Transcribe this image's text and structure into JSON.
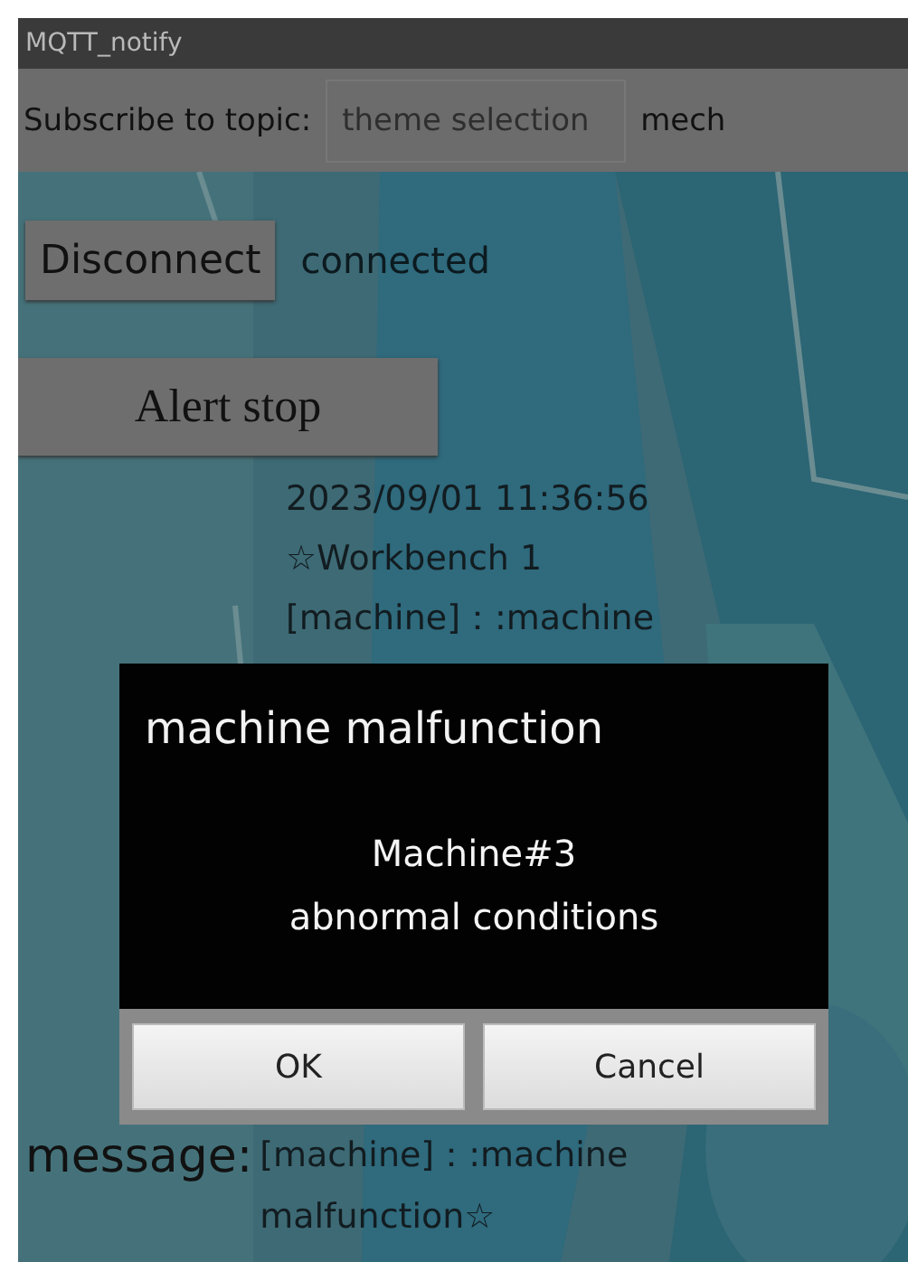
{
  "window": {
    "title": "MQTT_notify"
  },
  "subscribe": {
    "label": "Subscribe to topic:",
    "placeholder": "theme selection",
    "topic": "mech"
  },
  "connection": {
    "button": "Disconnect",
    "status": "connected"
  },
  "alert_button": "Alert stop",
  "log": [
    "2023/09/01  11:36:56",
    "☆Workbench 1",
    "[machine]：:machine"
  ],
  "message": {
    "label": "message:",
    "text": "[machine]：:machine malfunction☆"
  },
  "dialog": {
    "title": "machine malfunction",
    "body": [
      "Machine#3",
      "abnormal conditions"
    ],
    "buttons": [
      "OK",
      "Cancel"
    ]
  }
}
